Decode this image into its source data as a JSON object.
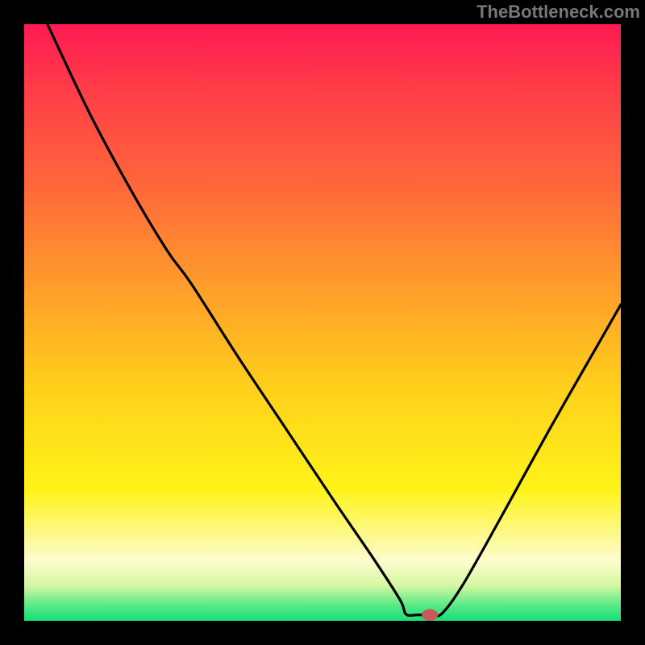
{
  "watermark": "TheBottleneck.com",
  "chart_data": {
    "type": "line",
    "title": "",
    "xlabel": "",
    "ylabel": "",
    "xlim": [
      0,
      100
    ],
    "ylim": [
      0,
      100
    ],
    "grid": false,
    "legend": false,
    "curve_points": [
      {
        "x": 3.9,
        "y": 100.0
      },
      {
        "x": 11.0,
        "y": 85.0
      },
      {
        "x": 18.0,
        "y": 72.0
      },
      {
        "x": 24.0,
        "y": 62.0
      },
      {
        "x": 28.0,
        "y": 56.5
      },
      {
        "x": 36.0,
        "y": 44.0
      },
      {
        "x": 44.0,
        "y": 32.0
      },
      {
        "x": 52.0,
        "y": 20.0
      },
      {
        "x": 58.5,
        "y": 10.5
      },
      {
        "x": 63.0,
        "y": 3.5
      },
      {
        "x": 64.0,
        "y": 1.1
      },
      {
        "x": 66.0,
        "y": 1.0
      },
      {
        "x": 68.2,
        "y": 1.0
      },
      {
        "x": 70.0,
        "y": 1.2
      },
      {
        "x": 73.5,
        "y": 6.0
      },
      {
        "x": 80.0,
        "y": 17.5
      },
      {
        "x": 88.0,
        "y": 32.0
      },
      {
        "x": 96.0,
        "y": 46.0
      },
      {
        "x": 100.0,
        "y": 53.0
      }
    ],
    "marker": {
      "x": 68.0,
      "y": 1.0,
      "rx": 1.3,
      "ry": 0.9
    },
    "curve_color": "#000000",
    "marker_color": "#c9595a"
  }
}
